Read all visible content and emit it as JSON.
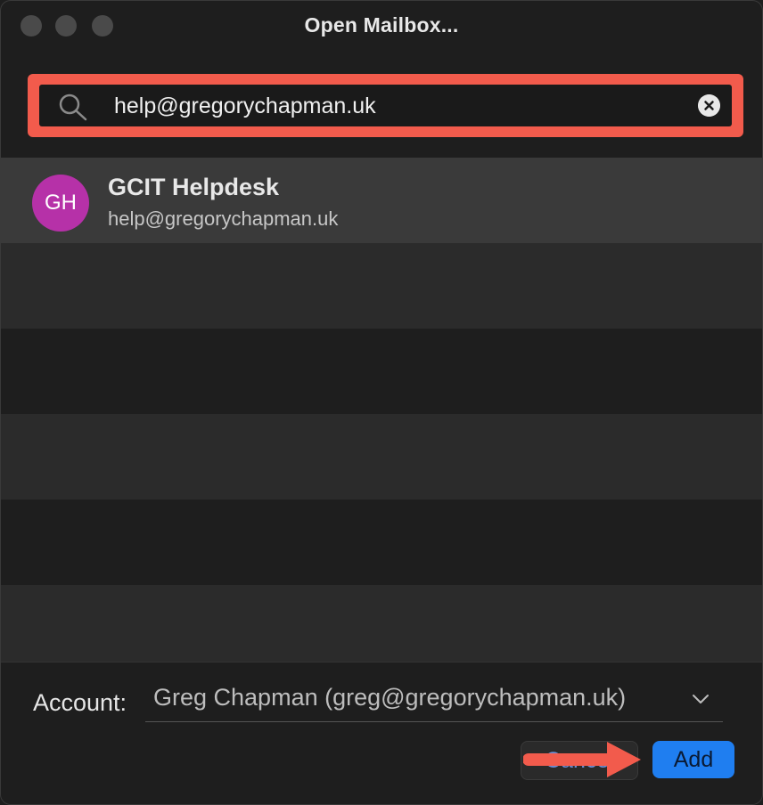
{
  "window": {
    "title": "Open Mailbox..."
  },
  "search": {
    "value": "help@gregorychapman.uk"
  },
  "results": [
    {
      "initials": "GH",
      "name": "GCIT Helpdesk",
      "email": "help@gregorychapman.uk"
    }
  ],
  "footer": {
    "account_label": "Account:",
    "account_value": "Greg Chapman (greg@gregorychapman.uk)",
    "cancel_label": "Cancel",
    "add_label": "Add"
  },
  "colors": {
    "highlight": "#f25b4c",
    "avatar": "#b631a8",
    "primary_button": "#1f7ef0"
  }
}
